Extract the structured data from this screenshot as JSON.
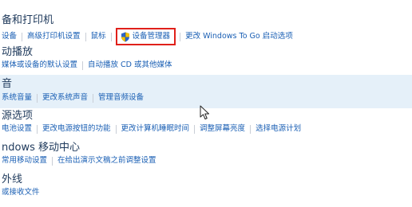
{
  "sections": [
    {
      "title": "备和打印机",
      "links": [
        "设备",
        "高级打印机设置",
        "鼠标",
        "设备管理器",
        "更改 Windows To Go 启动选项"
      ]
    },
    {
      "title": "动播放",
      "links": [
        "媒体或设备的默认设置",
        "自动播放 CD 或其他媒体"
      ]
    },
    {
      "title": "音",
      "links": [
        "系统音量",
        "更改系统声音",
        "管理音频设备"
      ]
    },
    {
      "title": "源选项",
      "links": [
        "电池设置",
        "更改电源按钮的功能",
        "更改计算机睡眠时间",
        "调整屏幕亮度",
        "选择电源计划"
      ]
    },
    {
      "title": "ndows 移动中心",
      "links": [
        "常用移动设置",
        "在给出演示文稿之前调整设置"
      ]
    },
    {
      "title": "外线",
      "links": [
        "或接收文件"
      ]
    }
  ],
  "icons": {
    "device_manager": "uac-shield-icon",
    "pointer": "mouse-cursor-icon"
  },
  "colors": {
    "link": "#1a5fb4",
    "title": "#1e395b",
    "highlight_row": "#e5f0f9",
    "annotation_box": "#e0201a"
  }
}
